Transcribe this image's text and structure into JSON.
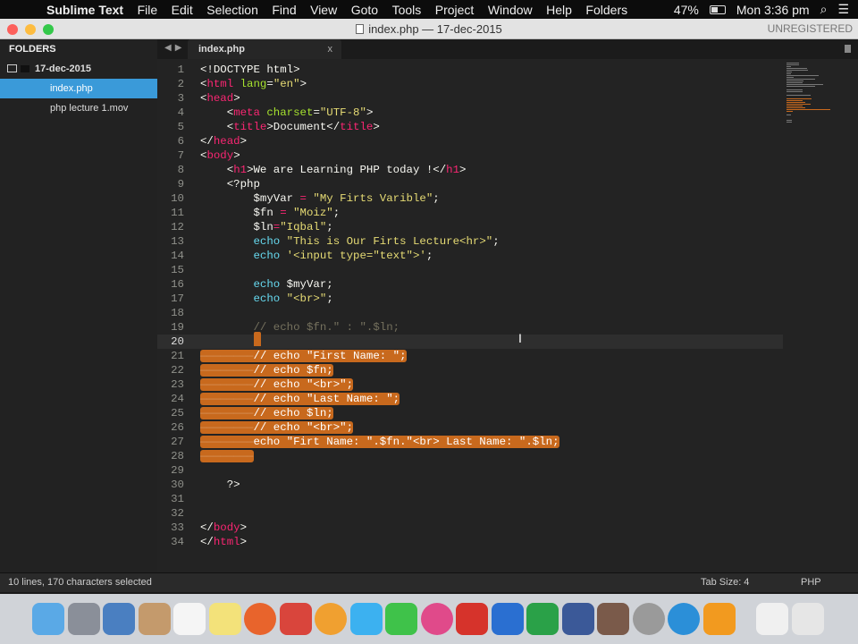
{
  "menubar": {
    "app": "Sublime Text",
    "items": [
      "File",
      "Edit",
      "Selection",
      "Find",
      "View",
      "Goto",
      "Tools",
      "Project",
      "Window",
      "Help",
      "Folders"
    ],
    "battery": "47%",
    "clock": "Mon 3:36 pm"
  },
  "window": {
    "title": "index.php — 17-dec-2015",
    "unregistered": "UNREGISTERED"
  },
  "sidebar": {
    "header": "FOLDERS",
    "folder": "17-dec-2015",
    "files": [
      {
        "label": "index.php",
        "active": true
      },
      {
        "label": "php lecture 1.mov",
        "active": false
      }
    ]
  },
  "tabs": [
    {
      "label": "index.php",
      "close": "x"
    }
  ],
  "editor": {
    "lines": [
      [
        [
          "",
          "<!DOCTYPE html>"
        ]
      ],
      [
        [
          "",
          "<"
        ],
        [
          "tag",
          "html"
        ],
        [
          "",
          ""
        ],
        [
          "attr",
          " lang"
        ],
        [
          "",
          "="
        ],
        [
          "str",
          "\"en\""
        ],
        [
          "",
          ">"
        ]
      ],
      [
        [
          "",
          "<"
        ],
        [
          "tag",
          "head"
        ],
        [
          "",
          ">"
        ]
      ],
      [
        [
          "",
          "    <"
        ],
        [
          "tag",
          "meta"
        ],
        [
          "attr",
          " charset"
        ],
        [
          "",
          "="
        ],
        [
          "str",
          "\"UTF-8\""
        ],
        [
          "",
          ">"
        ]
      ],
      [
        [
          "",
          "    <"
        ],
        [
          "tag",
          "title"
        ],
        [
          "",
          ">Document</"
        ],
        [
          "tag",
          "title"
        ],
        [
          "",
          ">"
        ]
      ],
      [
        [
          "",
          "</"
        ],
        [
          "tag",
          "head"
        ],
        [
          "",
          ">"
        ]
      ],
      [
        [
          "",
          "<"
        ],
        [
          "tag",
          "body"
        ],
        [
          "",
          ">"
        ]
      ],
      [
        [
          "",
          "    <"
        ],
        [
          "tag",
          "h1"
        ],
        [
          "",
          ">We are Learning PHP today !</"
        ],
        [
          "tag",
          "h1"
        ],
        [
          "",
          ">"
        ]
      ],
      [
        [
          "",
          "    <?php"
        ]
      ],
      [
        [
          "",
          "        $myVar "
        ],
        [
          "op",
          "="
        ],
        [
          "str",
          " \"My Firts Varible\""
        ],
        [
          "",
          ";"
        ]
      ],
      [
        [
          "",
          "        $fn "
        ],
        [
          "op",
          "="
        ],
        [
          "str",
          " \"Moiz\""
        ],
        [
          "",
          ";"
        ]
      ],
      [
        [
          "",
          "        $ln"
        ],
        [
          "op",
          "="
        ],
        [
          "str",
          "\"Iqbal\""
        ],
        [
          "",
          ";"
        ]
      ],
      [
        [
          "",
          "        "
        ],
        [
          "kw",
          "echo"
        ],
        [
          "str",
          " \"This is Our Firts Lecture<hr>\""
        ],
        [
          "",
          ";"
        ]
      ],
      [
        [
          "",
          "        "
        ],
        [
          "kw",
          "echo"
        ],
        [
          "str",
          " '<input type=\"text\">'"
        ],
        [
          "",
          ";"
        ]
      ],
      [],
      [
        [
          "",
          "        "
        ],
        [
          "kw",
          "echo"
        ],
        [
          "",
          " $myVar;"
        ]
      ],
      [
        [
          "",
          "        "
        ],
        [
          "kw",
          "echo"
        ],
        [
          "str",
          " \"<br>\""
        ],
        [
          "",
          ";"
        ]
      ],
      [],
      [
        [
          "",
          "        "
        ],
        [
          "cm",
          "// echo $fn.\" : \".$ln;"
        ]
      ],
      [],
      [
        [
          "ws",
          "————————"
        ],
        [
          "",
          "// echo \"First Name: \";"
        ]
      ],
      [
        [
          "ws",
          "————————"
        ],
        [
          "",
          "// echo $fn;"
        ]
      ],
      [
        [
          "ws",
          "————————"
        ],
        [
          "",
          "// echo \"<br>\";"
        ]
      ],
      [
        [
          "ws",
          "————————"
        ],
        [
          "",
          "// echo \"Last Name: \";"
        ]
      ],
      [
        [
          "ws",
          "————————"
        ],
        [
          "",
          "// echo $ln;"
        ]
      ],
      [
        [
          "ws",
          "————————"
        ],
        [
          "",
          "// echo \"<br>\";"
        ]
      ],
      [
        [
          "ws",
          "————————"
        ],
        [
          "",
          "echo \"Firt Name: \".$fn.\"<br> Last Name: \".$ln;"
        ]
      ],
      [
        [
          "ws",
          "————————"
        ]
      ],
      [],
      [
        [
          "",
          "    ?>"
        ]
      ],
      [],
      [],
      [
        [
          "",
          "</"
        ],
        [
          "tag",
          "body"
        ],
        [
          "",
          ">"
        ]
      ],
      [
        [
          "",
          "</"
        ],
        [
          "tag",
          "html"
        ],
        [
          "",
          ">"
        ]
      ]
    ],
    "selected_lines": [
      21,
      22,
      23,
      24,
      25,
      26,
      27,
      28
    ],
    "current_line": 20
  },
  "status": {
    "selection": "10 lines, 170 characters selected",
    "tab_size": "Tab Size: 4",
    "syntax": "PHP"
  },
  "dock": [
    "finder",
    "launchpad",
    "preview",
    "contacts",
    "reminders",
    "notes",
    "firefox",
    "photo-booth",
    "photos",
    "messages",
    "facetime",
    "itunes",
    "wps-presentation",
    "wps-writer",
    "wps-spreadsheet",
    "facebook",
    "user-photo",
    "itunes-alt",
    "safari-alt",
    "sublime-text",
    "documents",
    "trash"
  ],
  "colors": {
    "selection": "#c8691d",
    "sidebar_active": "#3a9ad9"
  }
}
